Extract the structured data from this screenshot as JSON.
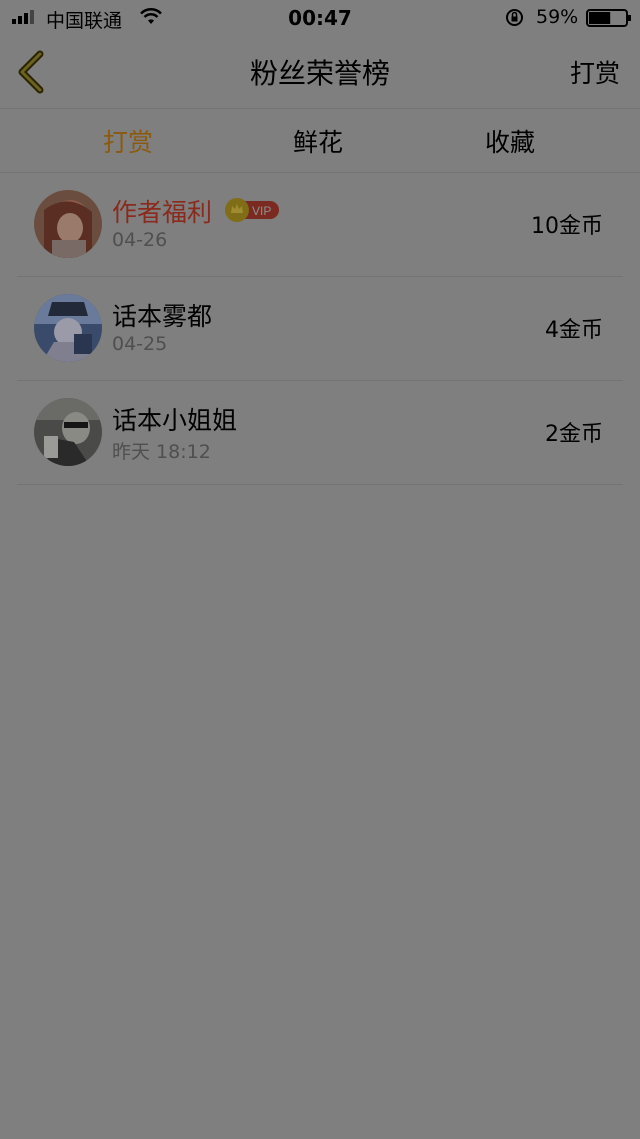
{
  "status_bar": {
    "carrier": "中国联通",
    "time": "00:47",
    "battery_percent": "59%",
    "battery_level": 0.59
  },
  "nav": {
    "title": "粉丝荣誉榜",
    "right_action": "打赏"
  },
  "tabs": [
    {
      "label": "打赏",
      "active": true
    },
    {
      "label": "鲜花",
      "active": false
    },
    {
      "label": "收藏",
      "active": false
    }
  ],
  "entries": [
    {
      "name": "作者福利",
      "date": "04-26",
      "amount": "10金币",
      "vip": true,
      "vip_label": "VIP"
    },
    {
      "name": "话本雾都",
      "date": "04-25",
      "amount": "4金币",
      "vip": false
    },
    {
      "name": "话本小姐姐",
      "date": "昨天 18:12",
      "amount": "2金币",
      "vip": false
    }
  ],
  "colors": {
    "overlay_background": "#7f7f7f",
    "active_tab": "#8a5a12",
    "vip_name": "#8a2a1c"
  }
}
